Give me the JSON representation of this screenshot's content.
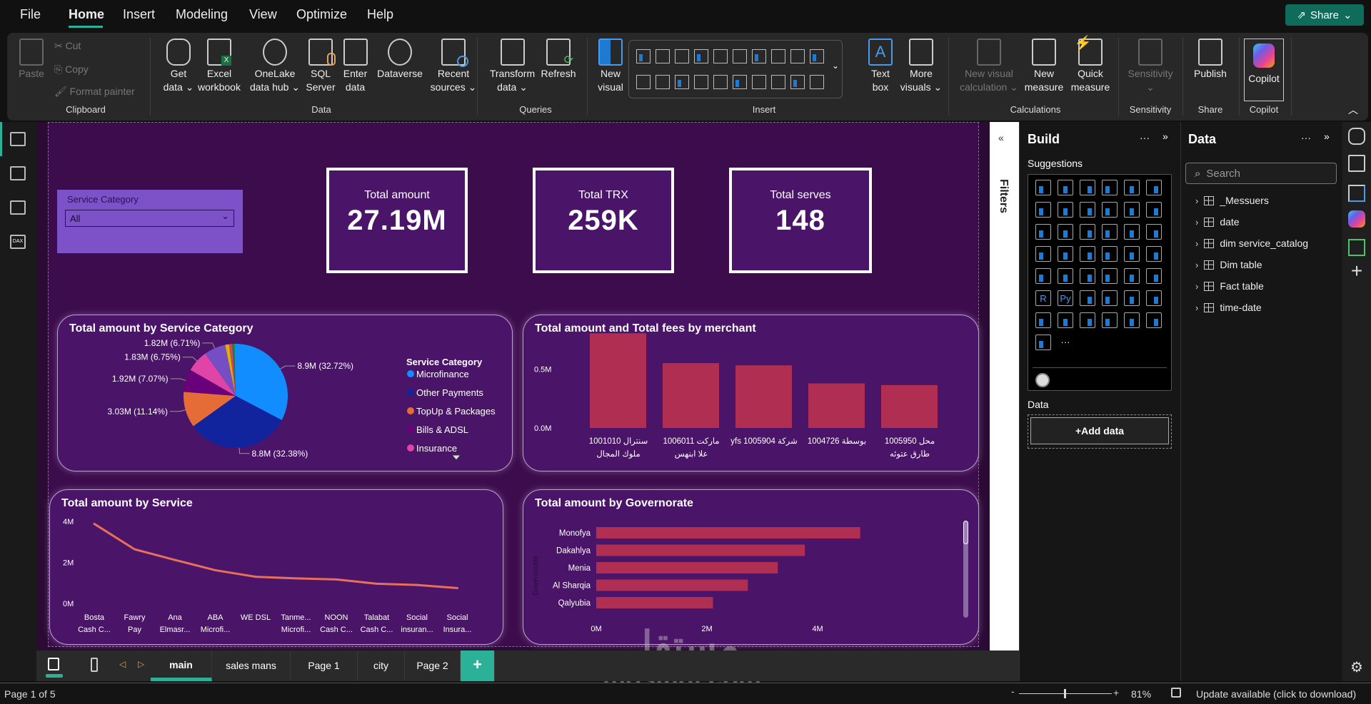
{
  "menu": {
    "items": [
      "File",
      "Home",
      "Insert",
      "Modeling",
      "View",
      "Optimize",
      "Help"
    ],
    "active": "Home",
    "share": "Share"
  },
  "ribbon": {
    "clipboard": {
      "paste": "Paste",
      "cut": "Cut",
      "copy": "Copy",
      "format_painter": "Format painter",
      "group": "Clipboard"
    },
    "data": {
      "get_data": [
        "Get",
        "data ⌄"
      ],
      "excel": [
        "Excel",
        "workbook"
      ],
      "onelake": [
        "OneLake",
        "data hub ⌄"
      ],
      "sql": [
        "SQL",
        "Server"
      ],
      "enter": [
        "Enter",
        "data"
      ],
      "dataverse": [
        "Dataverse",
        ""
      ],
      "recent": [
        "Recent",
        "sources ⌄"
      ],
      "group": "Data"
    },
    "queries": {
      "transform": [
        "Transform",
        "data ⌄"
      ],
      "refresh": [
        "Refresh",
        ""
      ],
      "group": "Queries"
    },
    "insert": {
      "new_visual": [
        "New",
        "visual"
      ],
      "text_box": [
        "Text",
        "box"
      ],
      "more_visuals": [
        "More",
        "visuals ⌄"
      ],
      "group": "Insert"
    },
    "calculations": {
      "new_visual_calc": [
        "New visual",
        "calculation ⌄"
      ],
      "new_measure": [
        "New",
        "measure"
      ],
      "quick_measure": [
        "Quick",
        "measure"
      ],
      "group": "Calculations"
    },
    "sensitivity": {
      "label": [
        "Sensitivity",
        "⌄"
      ],
      "group": "Sensitivity"
    },
    "share": {
      "publish": [
        "Publish",
        ""
      ],
      "group": "Share"
    },
    "copilot": {
      "label": [
        "Copilot",
        ""
      ],
      "group": "Copilot"
    }
  },
  "slicer": {
    "title": "Service Category",
    "value": "All"
  },
  "cards": [
    {
      "label": "Total amount",
      "value": "27.19M"
    },
    {
      "label": "Total TRX",
      "value": "259K"
    },
    {
      "label": "Total serves",
      "value": "148"
    }
  ],
  "chart_data": [
    {
      "type": "pie",
      "title": "Total amount by Service Category",
      "legend_title": "Service Category",
      "legend_position": "right",
      "slices": [
        {
          "name": "Microfinance",
          "label": "8.9M (32.72%)",
          "value": 32.72,
          "color": "#118dff"
        },
        {
          "name": "Other Payments",
          "label": "8.8M (32.38%)",
          "value": 32.38,
          "color": "#12239e"
        },
        {
          "name": "TopUp & Packages",
          "label": "3.03M (11.14%)",
          "value": 11.14,
          "color": "#e66c37"
        },
        {
          "name": "Bills & ADSL",
          "label": "1.92M (7.07%)",
          "value": 7.07,
          "color": "#6b007b"
        },
        {
          "name": "Insurance",
          "label": "1.83M (6.75%)",
          "value": 6.75,
          "color": "#e044a7"
        },
        {
          "label": "1.82M (6.71%)",
          "value": 6.71,
          "color": "#744ec2"
        },
        {
          "value": 1.2,
          "color": "#d9b300"
        },
        {
          "value": 1.0,
          "color": "#d64550"
        },
        {
          "value": 0.6,
          "color": "#197278"
        },
        {
          "value": 0.43,
          "color": "#1aab40"
        }
      ]
    },
    {
      "type": "bar",
      "title": "Total amount and Total fees by merchant",
      "categories": [
        [
          "سنترال 1001010",
          "ملوك المجال"
        ],
        [
          "ماركت 1006011",
          "علا ابنهس"
        ],
        [
          "yfs شركة 1005904",
          ""
        ],
        [
          "بوسطة 1004726",
          ""
        ],
        [
          "محل 1005950",
          "طارق عتوئه"
        ]
      ],
      "values": [
        0.806,
        0.552,
        0.533,
        0.379,
        0.365
      ],
      "unit": "M",
      "yticks": [
        "0.0M",
        "0.5M"
      ],
      "ylim": [
        0,
        0.85
      ],
      "color": "#b02e52"
    },
    {
      "type": "line",
      "title": "Total amount by Service",
      "categories": [
        [
          "Bosta",
          "Cash C..."
        ],
        [
          "Fawry",
          "Pay"
        ],
        [
          "Ana",
          "Elmasr..."
        ],
        [
          "ABA",
          "Microfi..."
        ],
        [
          "WE DSL",
          ""
        ],
        [
          "Tanme...",
          "Microfi..."
        ],
        [
          "NOON",
          "Cash C..."
        ],
        [
          "Talabat",
          "Cash C..."
        ],
        [
          "Social",
          "insuran..."
        ],
        [
          "Social",
          "Insura..."
        ]
      ],
      "values": [
        3.88,
        2.64,
        2.12,
        1.62,
        1.3,
        1.22,
        1.17,
        0.96,
        0.9,
        0.75
      ],
      "unit": "M",
      "yticks": [
        "0M",
        "2M",
        "4M"
      ],
      "ylim": [
        0,
        4
      ],
      "color": "#e8705a"
    },
    {
      "type": "bar",
      "orientation": "horizontal",
      "title": "Total amount by Governorate",
      "ylabel": "Governorate",
      "categories": [
        "Monofya",
        "Dakahlya",
        "Menia",
        "Al Sharqia",
        "Qalyubia"
      ],
      "values": [
        4.77,
        3.77,
        3.28,
        2.74,
        2.11
      ],
      "unit": "M",
      "xticks": [
        "0M",
        "2M",
        "4M"
      ],
      "xlim": [
        0,
        4.9
      ],
      "color": "#b02e52"
    }
  ],
  "filters": {
    "label": "Filters"
  },
  "build": {
    "title": "Build",
    "suggestions": "Suggestions",
    "data_label": "Data",
    "add_data": "+Add data",
    "icons": [
      "stacked-bar",
      "stacked-column",
      "clustered-bar",
      "clustered-column",
      "100-bar",
      "100-column",
      "line",
      "area",
      "stacked-area",
      "100-area",
      "line-column",
      "line-clustered",
      "ribbon",
      "waterfall",
      "funnel",
      "scatter",
      "pie",
      "donut",
      "treemap",
      "map",
      "filled-map",
      "shape-map",
      "azure-map",
      "gauge",
      "card",
      "multi-row-card",
      "kpi",
      "slicer",
      "table",
      "matrix",
      "R",
      "Py",
      "key-influencers",
      "decomposition-tree",
      "qna",
      "paginated",
      "trophy",
      "report",
      "smart-narrative",
      "power-apps",
      "arcgis",
      "power-automate-diamond",
      "power-automate",
      "more"
    ]
  },
  "data_pane": {
    "title": "Data",
    "search_placeholder": "Search",
    "tables": [
      "_Messuers",
      "date",
      "dim service_catalog",
      "Dim table",
      "Fact table",
      "time-date"
    ]
  },
  "pages": {
    "tabs": [
      "main",
      "sales mans",
      "Page 1",
      "city",
      "Page 2"
    ],
    "active": "main",
    "add": "+"
  },
  "status": {
    "page": "Page 1 of 5",
    "zoom": "81%",
    "update": "Update available (click to download)",
    "zoom_level": 0.81
  },
  "watermark": {
    "arabic": "مستقل",
    "latin": "mostaql.com"
  }
}
